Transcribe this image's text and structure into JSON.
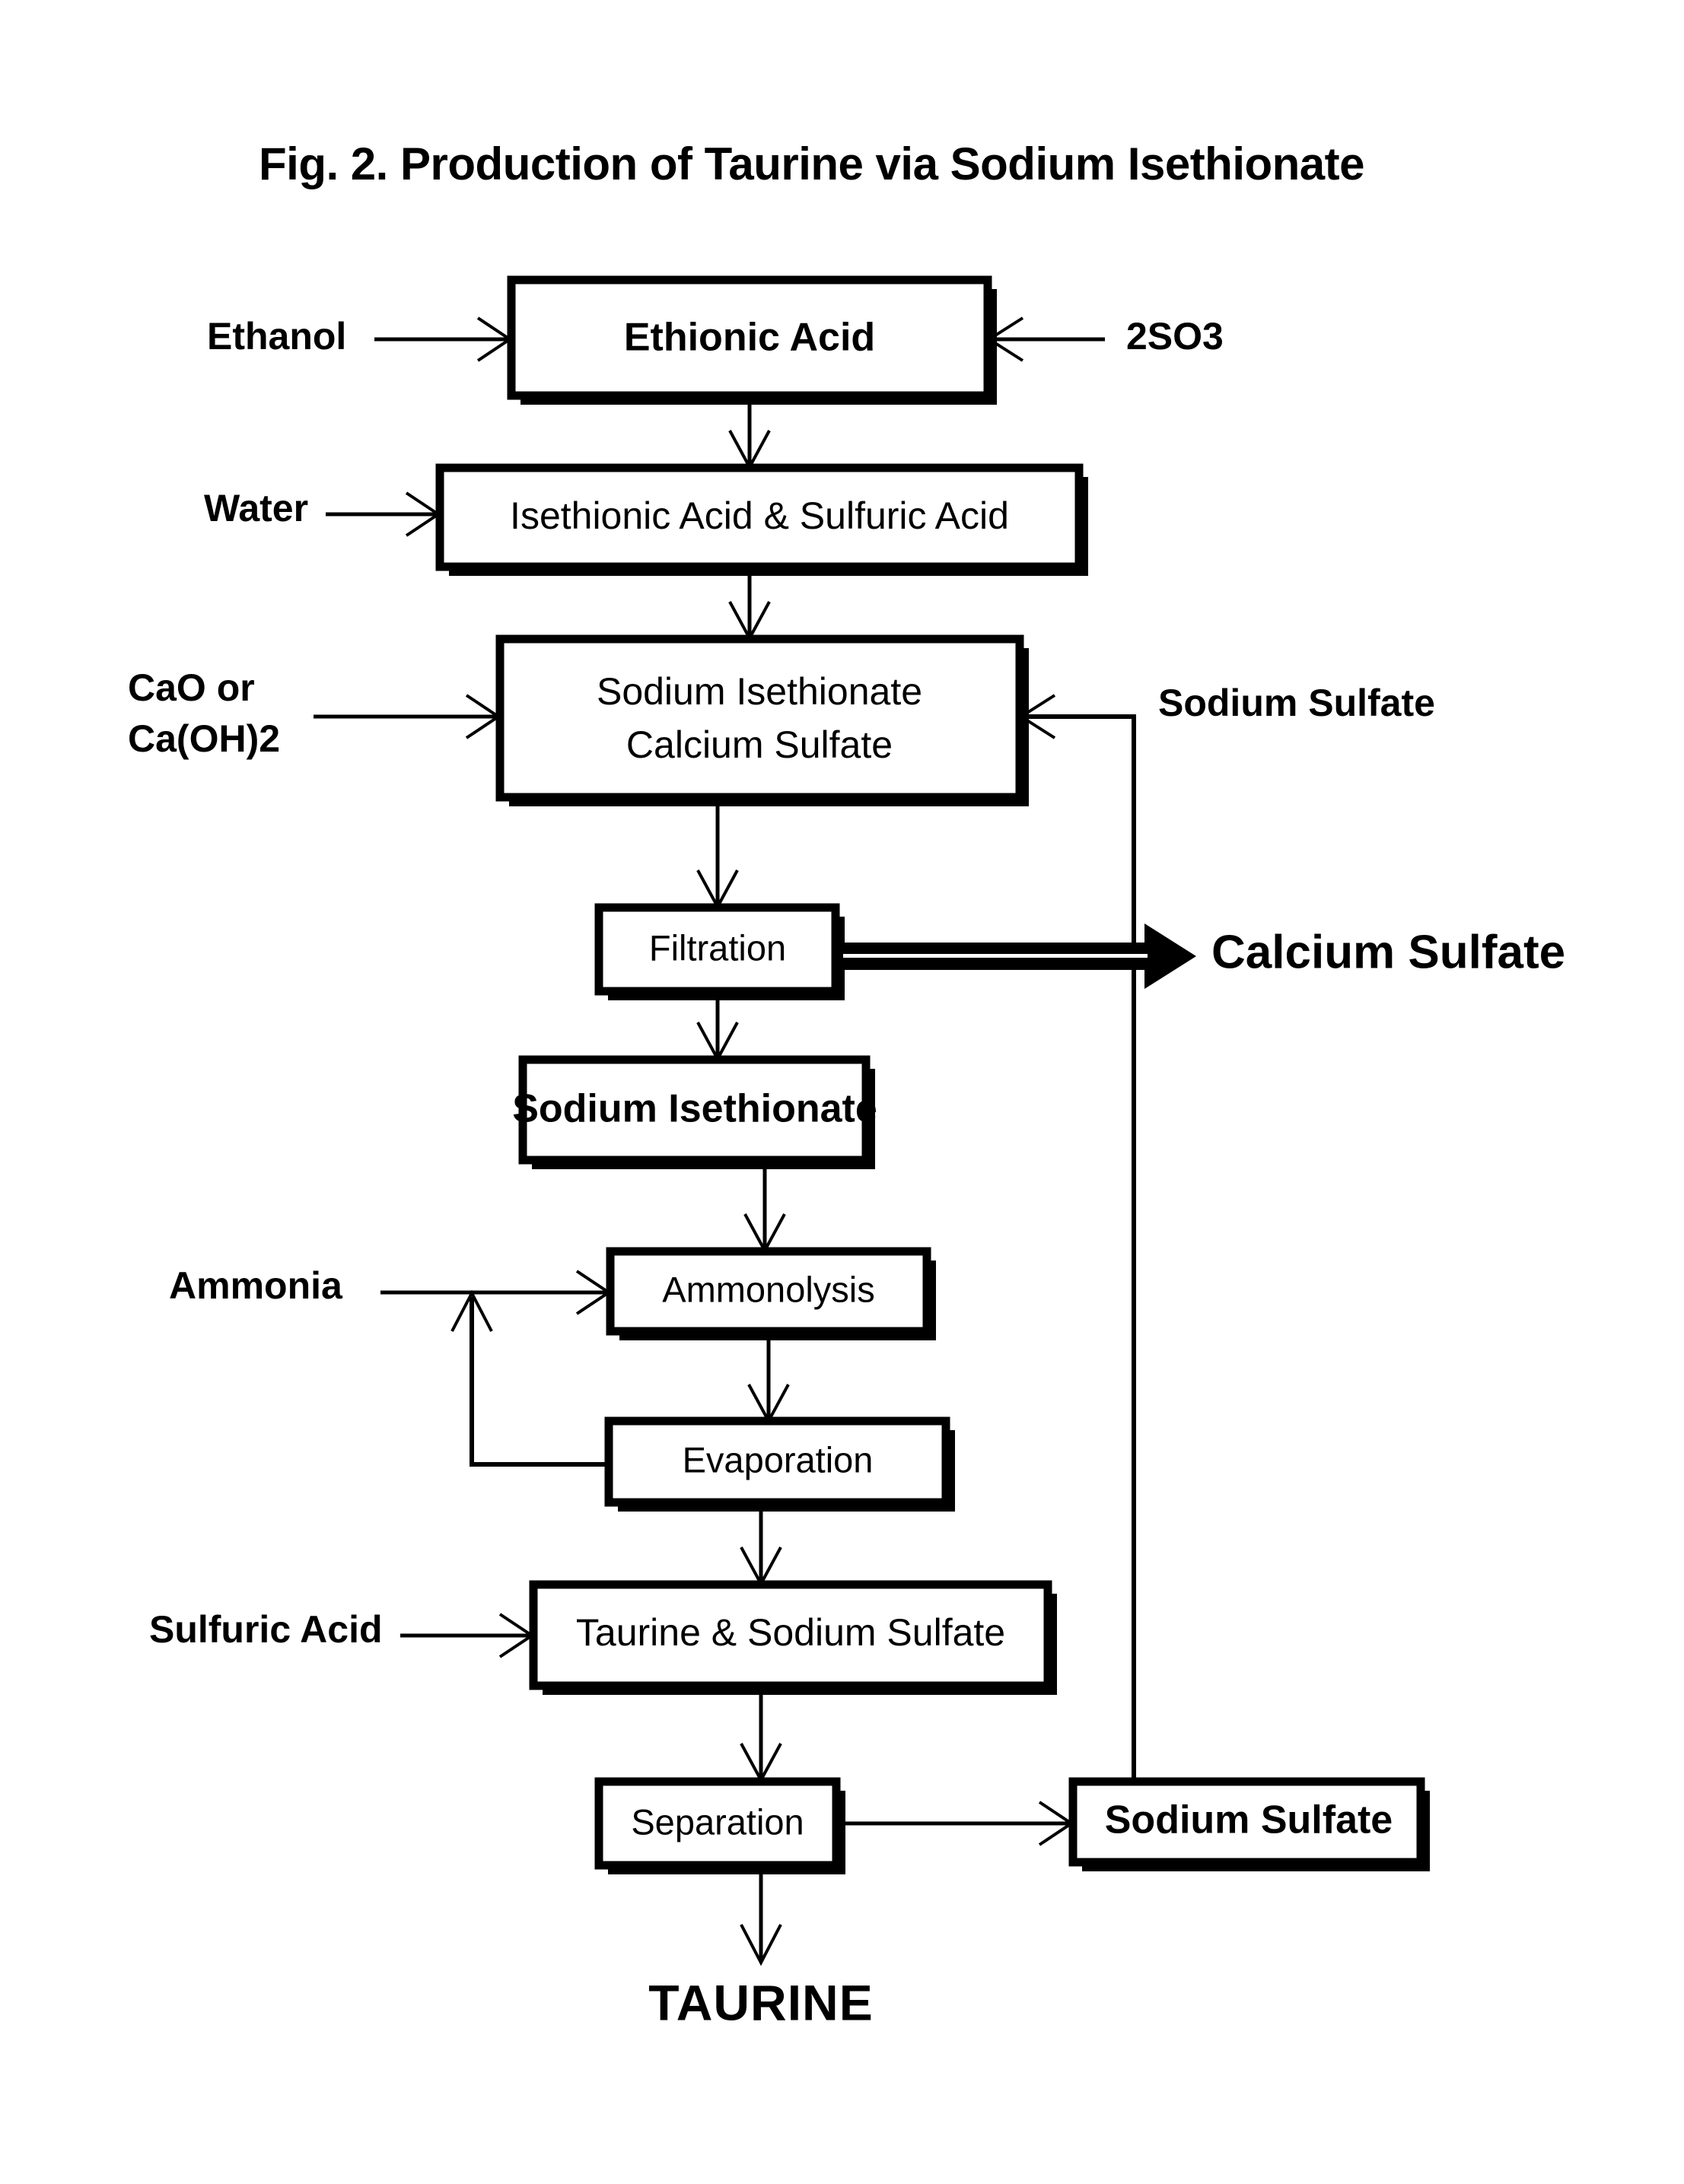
{
  "figure": {
    "title": "Fig. 2.  Production of Taurine via Sodium Isethionate"
  },
  "nodes": {
    "ethionic_acid": {
      "label": "Ethionic Acid"
    },
    "isethionic_sulfuric": {
      "label": "Isethionic Acid & Sulfuric Acid"
    },
    "sodium_isethionate_calcium_sulfate": {
      "line1": "Sodium Isethionate",
      "line2": "Calcium Sulfate"
    },
    "filtration": {
      "label": "Filtration"
    },
    "sodium_isethionate": {
      "label": "Sodium Isethionate"
    },
    "ammonolysis": {
      "label": "Ammonolysis"
    },
    "evaporation": {
      "label": "Evaporation"
    },
    "taurine_sodium_sulfate": {
      "label": "Taurine & Sodium Sulfate"
    },
    "separation": {
      "label": "Separation"
    },
    "sodium_sulfate_product": {
      "label": "Sodium Sulfate"
    }
  },
  "inputs": {
    "ethanol": {
      "label": "Ethanol"
    },
    "so3": {
      "label": "2SO3"
    },
    "water": {
      "label": "Water"
    },
    "cao": {
      "line1": "CaO or",
      "line2": "Ca(OH)2"
    },
    "sodium_sulfate_recycle": {
      "label": "Sodium Sulfate"
    },
    "ammonia": {
      "label": "Ammonia"
    },
    "sulfuric_acid": {
      "label": "Sulfuric Acid"
    }
  },
  "outputs": {
    "calcium_sulfate": {
      "label": "Calcium Sulfate"
    },
    "taurine": {
      "label": "TAURINE"
    }
  },
  "colors": {
    "ink": "#000000",
    "paper": "#ffffff"
  },
  "chart_data": {
    "type": "flowchart",
    "title": "Fig. 2.  Production of Taurine via Sodium Isethionate",
    "orientation": "top-to-bottom",
    "process_steps": [
      "Ethionic Acid",
      "Isethionic Acid & Sulfuric Acid",
      "Sodium Isethionate / Calcium Sulfate",
      "Filtration",
      "Sodium Isethionate",
      "Ammonolysis",
      "Evaporation",
      "Taurine & Sodium Sulfate",
      "Separation"
    ],
    "feed_streams": [
      {
        "label": "Ethanol",
        "into": "Ethionic Acid",
        "side": "left"
      },
      {
        "label": "2SO3",
        "into": "Ethionic Acid",
        "side": "right"
      },
      {
        "label": "Water",
        "into": "Isethionic Acid & Sulfuric Acid",
        "side": "left"
      },
      {
        "label": "CaO or Ca(OH)2",
        "into": "Sodium Isethionate / Calcium Sulfate",
        "side": "left"
      },
      {
        "label": "Sodium Sulfate",
        "into": "Sodium Isethionate / Calcium Sulfate",
        "side": "right",
        "recycle": true
      },
      {
        "label": "Ammonia",
        "into": "Ammonolysis",
        "side": "left"
      },
      {
        "label": "Sulfuric Acid",
        "into": "Taurine & Sodium Sulfate",
        "side": "left"
      }
    ],
    "product_streams": [
      {
        "label": "Calcium Sulfate",
        "from": "Filtration",
        "side": "right"
      },
      {
        "label": "Sodium Sulfate",
        "from": "Separation",
        "side": "right"
      },
      {
        "label": "TAURINE",
        "from": "Separation",
        "side": "bottom"
      }
    ],
    "recycle_loops": [
      {
        "from": "Evaporation",
        "to": "Ammonolysis",
        "stream": "Ammonia"
      },
      {
        "from": "Sodium Sulfate",
        "to": "Sodium Isethionate / Calcium Sulfate",
        "stream": "Sodium Sulfate"
      }
    ]
  }
}
